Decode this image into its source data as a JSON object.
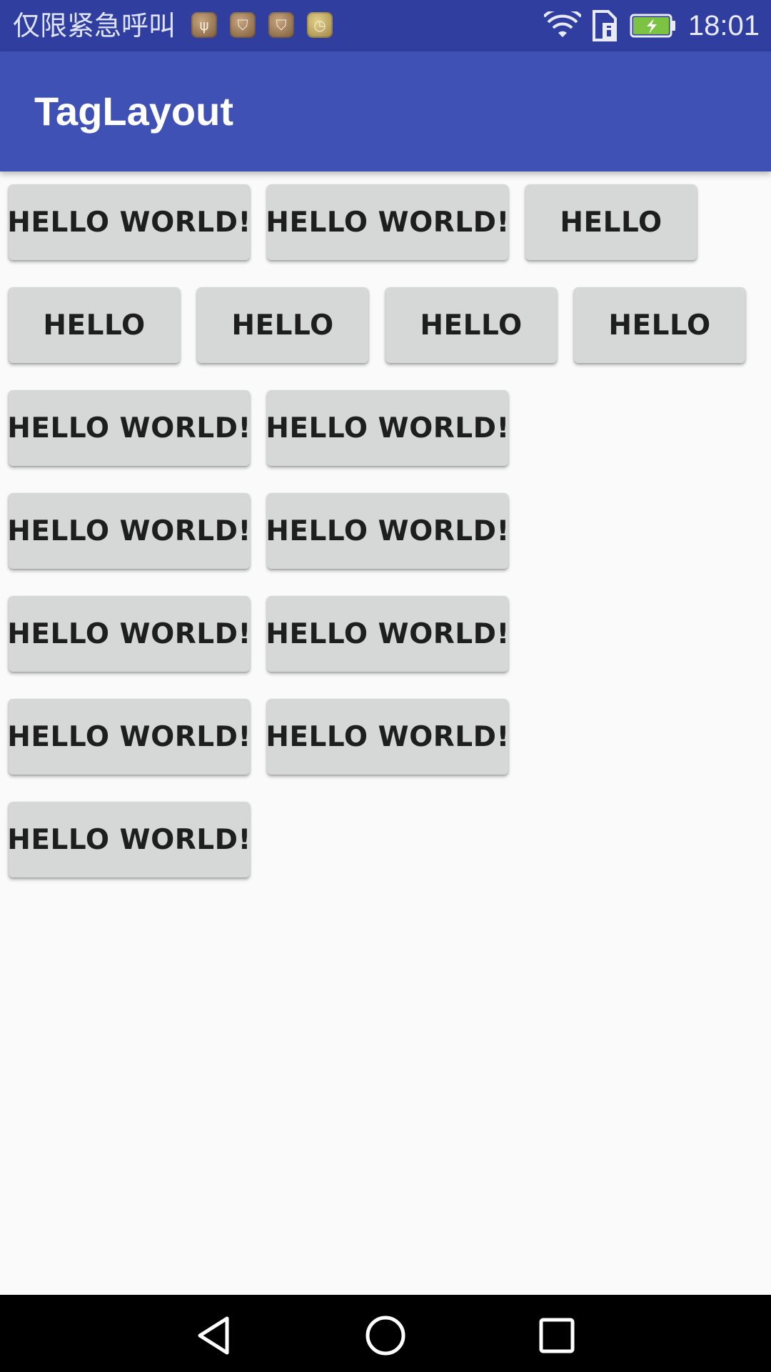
{
  "status_bar": {
    "carrier": "仅限紧急呼叫",
    "time": "18:01",
    "notification_icons": [
      "usb-icon",
      "shield-icon",
      "shield-icon",
      "clock-icon"
    ],
    "system_icons": [
      "wifi-icon",
      "sim-icon",
      "battery-charging-icon"
    ]
  },
  "app_bar": {
    "title": "TagLayout",
    "color": "#3f51b5",
    "status_color": "#303f9f"
  },
  "tags": {
    "row1": [
      "HELLO WORLD!",
      "HELLO WORLD!",
      "HELLO"
    ],
    "row2": [
      "HELLO",
      "HELLO",
      "HELLO",
      "HELLO"
    ],
    "row3": [
      "HELLO WORLD!",
      "HELLO WORLD!"
    ],
    "row4": [
      "HELLO WORLD!",
      "HELLO WORLD!"
    ],
    "row5": [
      "HELLO WORLD!",
      "HELLO WORLD!"
    ],
    "row6": [
      "HELLO WORLD!",
      "HELLO WORLD!"
    ],
    "row7": [
      "HELLO WORLD!"
    ]
  },
  "nav_bar": {
    "buttons": [
      "back-icon",
      "home-icon",
      "recents-icon"
    ]
  }
}
